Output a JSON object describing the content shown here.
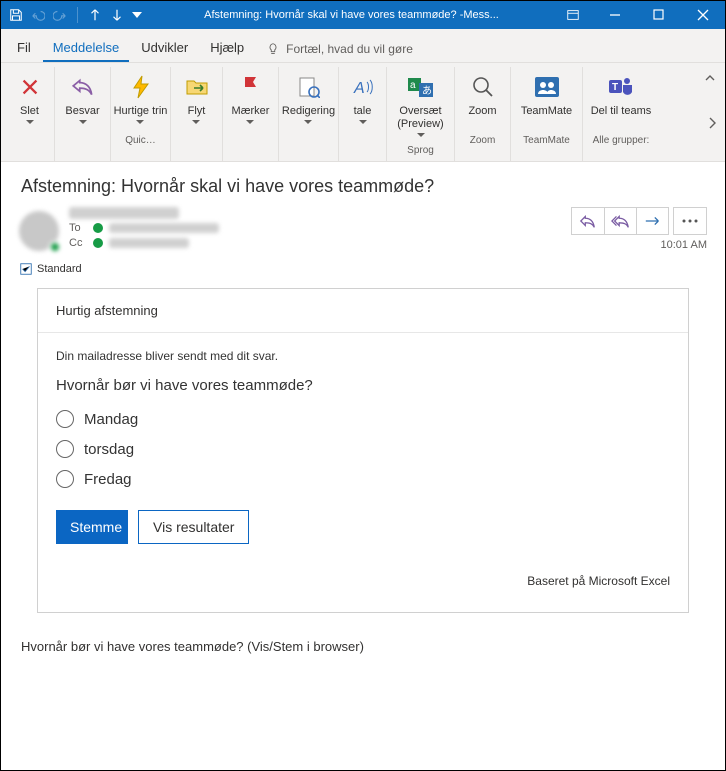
{
  "window": {
    "title": "Afstemning: Hvornår skal vi have vores teammøde? -Mess..."
  },
  "tabs": {
    "file": "Fil",
    "message": "Meddelelse",
    "developer": "Udvikler",
    "help": "Hjælp",
    "tellme": "Fortæl, hvad du vil gøre"
  },
  "ribbon": {
    "delete": "Slet",
    "reply": "Besvar",
    "quicksteps": "Hurtige trin",
    "move": "Flyt",
    "tags": "Mærker",
    "editing": "Redigering",
    "speech": "tale",
    "translate": "Oversæt (Preview)",
    "zoom": "Zoom",
    "teammate": "TeamMate",
    "shareteams": "Del til teams",
    "g_quicksteps": "Quic…",
    "g_language": "Sprog",
    "g_zoom": "Zoom",
    "g_teammate": "TeamMate",
    "g_allgroups": "Alle grupper:"
  },
  "message": {
    "subject": "Afstemning: Hvornår skal vi have vores teammøde?",
    "to": "To",
    "cc": "Cc",
    "time": "10:01 AM",
    "sensitivity": "Standard"
  },
  "poll": {
    "header": "Hurtig afstemning",
    "note": "Din mailadresse bliver sendt med dit svar.",
    "question": "Hvornår bør vi have vores teammøde?",
    "options": [
      "Mandag",
      "torsdag",
      "Fredag"
    ],
    "vote": "Stemme",
    "results": "Vis resultater",
    "brand": "Baseret på Microsoft Excel"
  },
  "footer": {
    "link": "Hvornår bør vi have vores teammøde? (Vis/Stem i browser)"
  }
}
